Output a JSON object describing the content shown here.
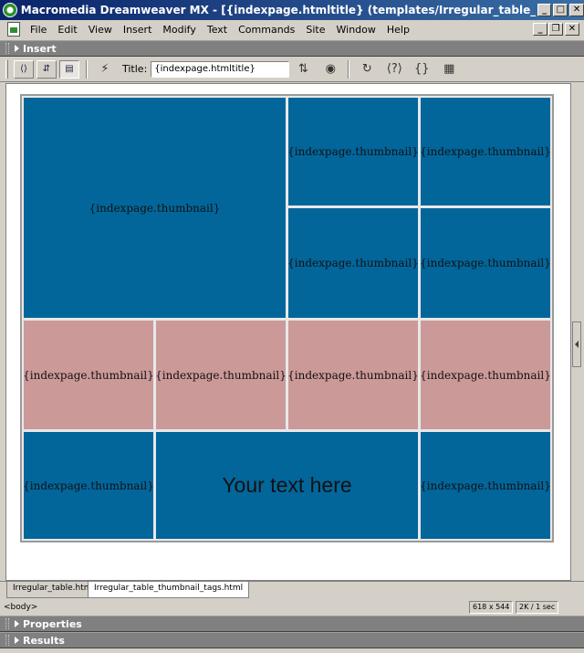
{
  "window": {
    "title": "Macromedia Dreamweaver MX - [{indexpage.htmltitle} (templates/Irregular_table_thumbnail_t...",
    "minimize": "_",
    "maximize": "□",
    "close": "✕"
  },
  "menu": {
    "items": [
      "File",
      "Edit",
      "View",
      "Insert",
      "Modify",
      "Text",
      "Commands",
      "Site",
      "Window",
      "Help"
    ],
    "doc_minimize": "_",
    "doc_restore": "❐",
    "doc_close": "✕"
  },
  "insert_panel": {
    "label": "Insert"
  },
  "toolbar": {
    "title_label": "Title:",
    "title_value": "{indexpage.htmltitle}",
    "code_view": "⟨⟩",
    "split_view": "⇵",
    "design_view": "▤",
    "live_data": "⚡",
    "file_mgmt": "⇅",
    "preview": "◉",
    "refresh": "↻",
    "reference": "⟨?⟩",
    "code_nav": "{}",
    "view_options": "▦"
  },
  "table": {
    "cells": [
      "{indexpage.thumbnail}",
      "{indexpage.thumbnail}",
      "{indexpage.thumbnail}",
      "{indexpage.thumbnail}",
      "{indexpage.thumbnail}",
      "{indexpage.thumbnail}",
      "{indexpage.thumbnail}",
      "{indexpage.thumbnail}",
      "{indexpage.thumbnail}",
      "{indexpage.thumbnail}",
      "Your text here",
      "{indexpage.thumbnail}"
    ],
    "colors": {
      "blue": "#02669b",
      "pink": "#cc9999"
    }
  },
  "tabs": [
    "Irregular_table.html",
    "Irregular_table_thumbnail_tags.html"
  ],
  "status": {
    "tag": "<body>",
    "window_size": "618 x 544",
    "download": "2K / 1 sec"
  },
  "panels": {
    "properties": "Properties",
    "results": "Results"
  }
}
